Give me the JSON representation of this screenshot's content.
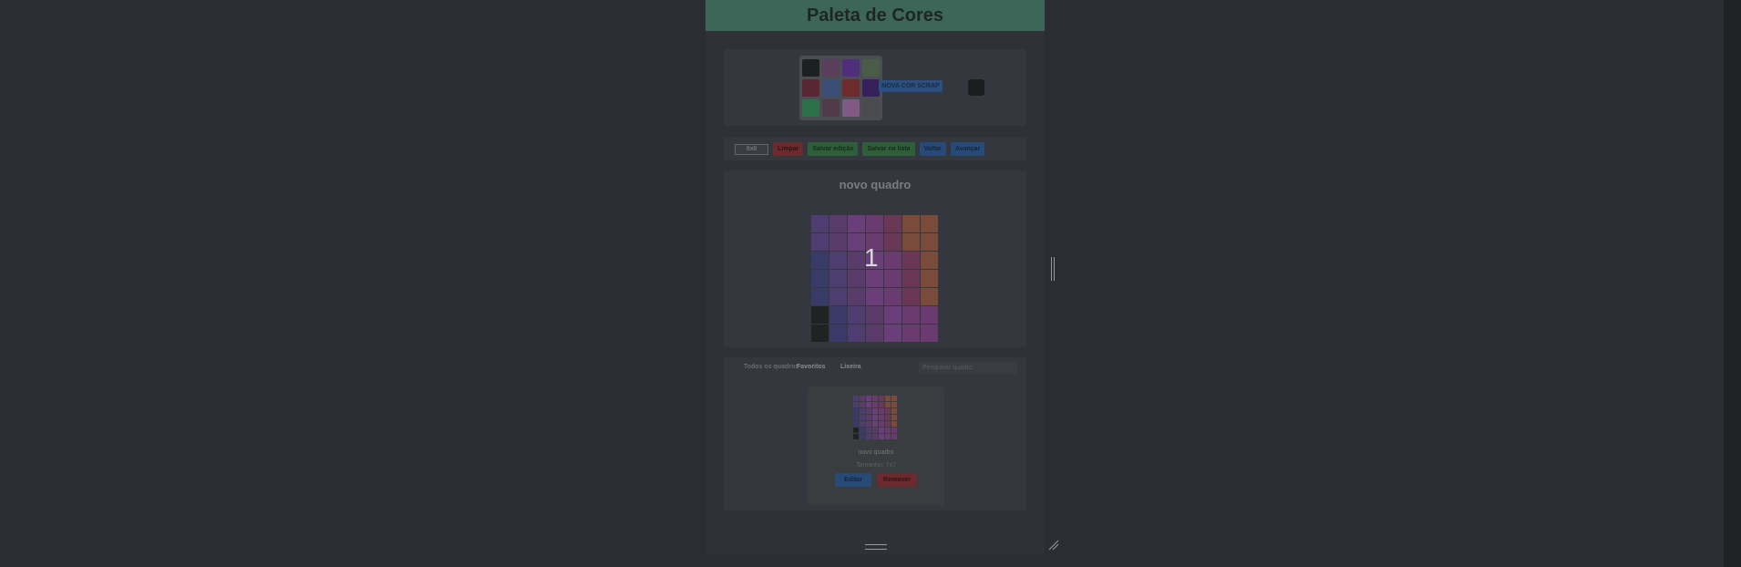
{
  "app": {
    "title": "Paleta de Cores"
  },
  "palette": {
    "swatches": [
      "#1d2021",
      "#5b3d5c",
      "#4f2f7c",
      "#4a5b48",
      "#5a2634",
      "#3a4e77",
      "#6e2b2e",
      "#36205c",
      "#2b7048",
      "#4f3a4a",
      "#7f5a86",
      "#4b4a4e"
    ],
    "new_color_label": "NOVA COR SCRAP",
    "current_color": "#1b1d20"
  },
  "toolbar": {
    "size_value": "8x8",
    "buttons": [
      {
        "label": "Limpar",
        "variant": "red"
      },
      {
        "label": "Salvar edição",
        "variant": "green"
      },
      {
        "label": "Salvar na lista",
        "variant": "green"
      },
      {
        "label": "Voltar",
        "variant": "blue"
      },
      {
        "label": "Avançar",
        "variant": "blue"
      }
    ]
  },
  "board": {
    "title": "novo quadro",
    "page_number": "1",
    "rows": [
      [
        "#4e3e70",
        "#5a3c6a",
        "#6a3e78",
        "#6a3b6e",
        "#6b3757",
        "#7a4a3a",
        "#7a4a3a"
      ],
      [
        "#4e3e70",
        "#5a3c6a",
        "#6a3e78",
        "#6a3b6e",
        "#6b3757",
        "#7a4a3a",
        "#7a4a3a"
      ],
      [
        "#3a3a68",
        "#4e3e70",
        "#5a3c6a",
        "#6a3e78",
        "#6a3b6e",
        "#6b3757",
        "#7a4a3a"
      ],
      [
        "#3a3a68",
        "#4e3e70",
        "#5a3c6a",
        "#6a3e78",
        "#6a3b6e",
        "#6b3757",
        "#7a4a3a"
      ],
      [
        "#3a3a68",
        "#4e3e70",
        "#5a3c6a",
        "#6a3e78",
        "#6a3b6e",
        "#6b3757",
        "#7a4a3a"
      ],
      [
        "#202324",
        "#3a3a68",
        "#4e3e70",
        "#5a3c6a",
        "#6a3e78",
        "#6a3b6e",
        "#6b3a6e"
      ],
      [
        "#202324",
        "#3a3a68",
        "#4e3e70",
        "#5a3c6a",
        "#6a3e78",
        "#6a3b6e",
        "#6b3a6e"
      ]
    ]
  },
  "library": {
    "tabs": [
      "Todos os quadros",
      "Favoritos",
      "Lixeira"
    ],
    "search_placeholder": "Pesquisar quadro",
    "card": {
      "name": "novo quadro",
      "size_text": "Tamanho: 7x7",
      "open_label": "Editar",
      "delete_label": "Remover"
    }
  }
}
